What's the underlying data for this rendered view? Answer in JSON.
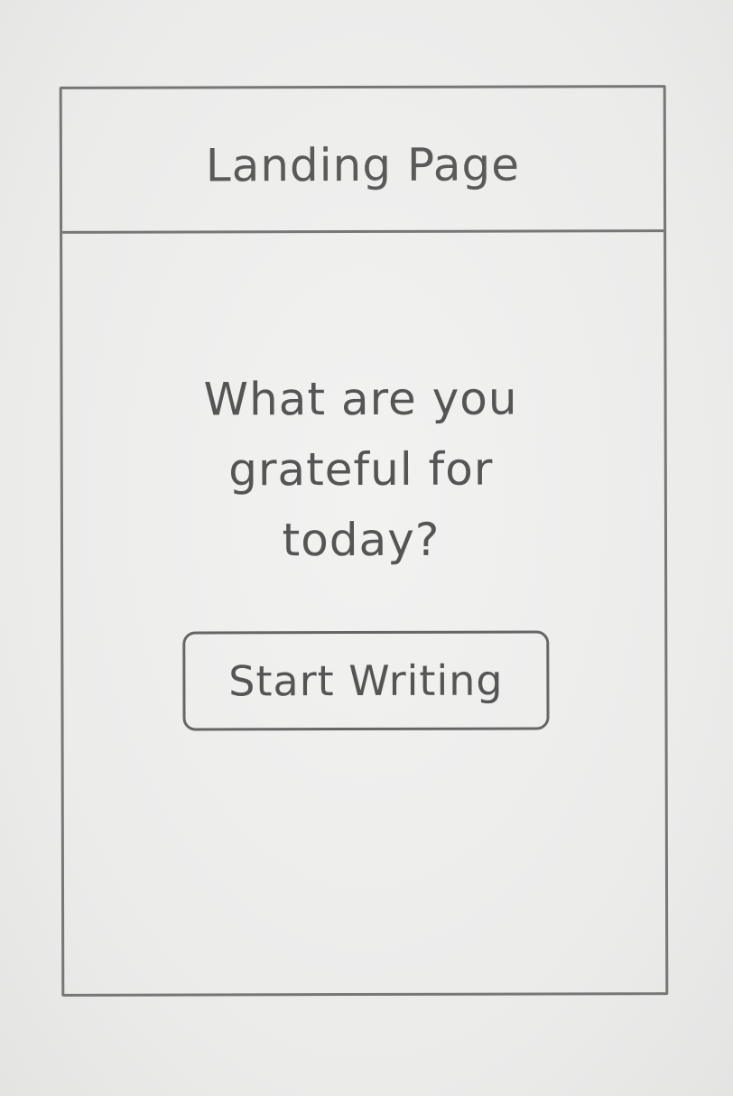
{
  "header": {
    "title": "Landing Page"
  },
  "main": {
    "prompt": "What are you grateful for today?",
    "start_button_label": "Start Writing"
  }
}
